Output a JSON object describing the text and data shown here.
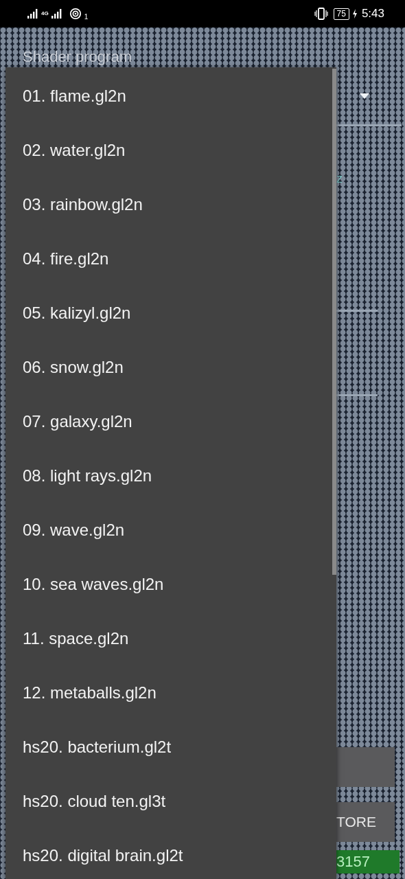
{
  "status_bar": {
    "network": "4G",
    "hotspot_count": "1",
    "battery": "75",
    "time": "5:43"
  },
  "field": {
    "label": "Shader program"
  },
  "dropdown": {
    "items": [
      {
        "label": "01. flame.gl2n"
      },
      {
        "label": "02. water.gl2n"
      },
      {
        "label": "03. rainbow.gl2n"
      },
      {
        "label": "04. fire.gl2n"
      },
      {
        "label": "05. kalizyl.gl2n"
      },
      {
        "label": "06. snow.gl2n"
      },
      {
        "label": "07. galaxy.gl2n"
      },
      {
        "label": "08. light rays.gl2n"
      },
      {
        "label": "09. wave.gl2n"
      },
      {
        "label": "10. sea waves.gl2n"
      },
      {
        "label": "11. space.gl2n"
      },
      {
        "label": "12. metaballs.gl2n"
      },
      {
        "label": "hs20. bacterium.gl2t"
      },
      {
        "label": "hs20. cloud ten.gl3t"
      },
      {
        "label": "hs20. digital brain.gl2t"
      }
    ]
  },
  "behind": {
    "hint": "z",
    "restore_button": {
      "label": "TORE"
    },
    "counter": "3157"
  }
}
